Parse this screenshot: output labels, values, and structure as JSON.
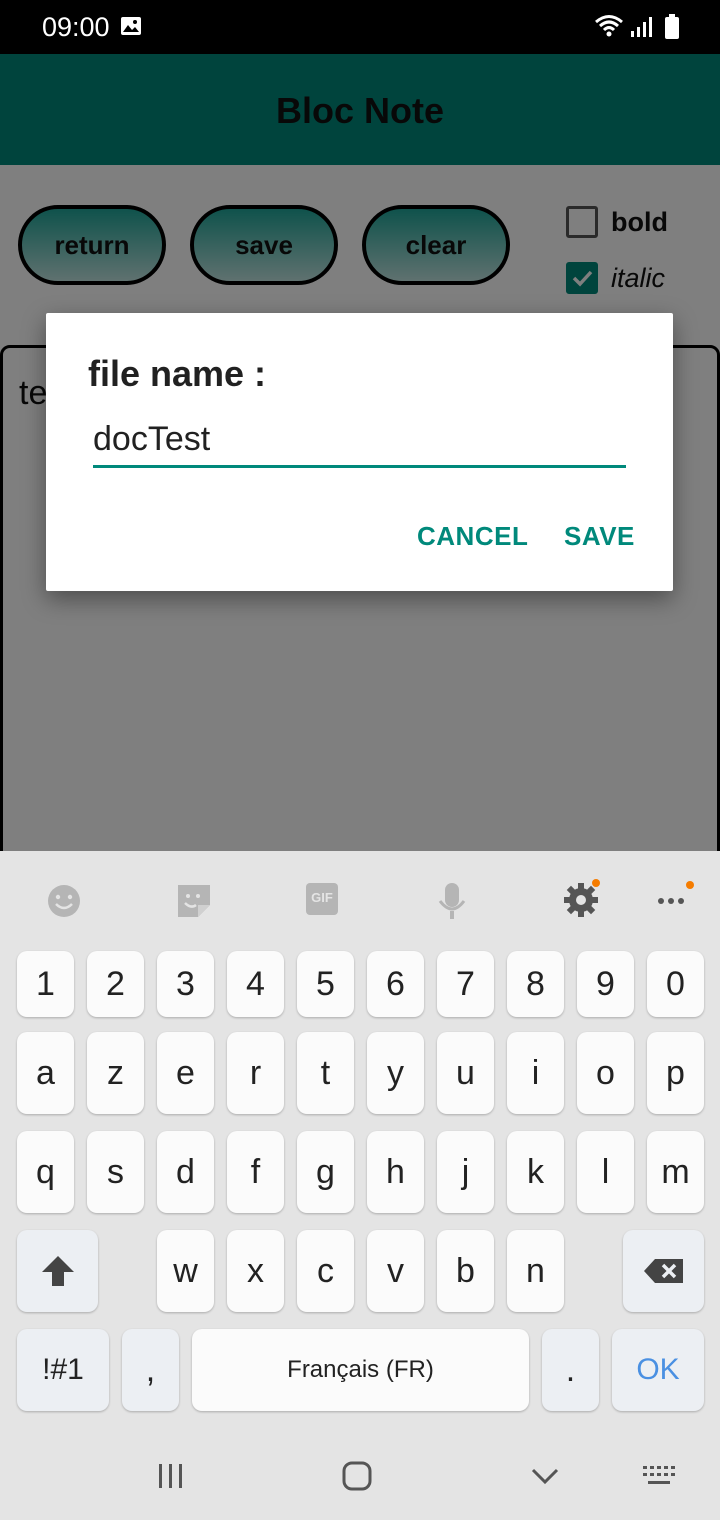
{
  "status_bar": {
    "time": "09:00"
  },
  "app": {
    "title": "Bloc Note"
  },
  "toolbar": {
    "return_label": "return",
    "save_label": "save",
    "clear_label": "clear",
    "bold_label": "bold",
    "bold_checked": false,
    "italic_label": "italic",
    "italic_checked": true
  },
  "editor": {
    "content": "te"
  },
  "dialog": {
    "title": "file name :",
    "filename_value": "docTest",
    "cancel_label": "CANCEL",
    "save_label": "SAVE"
  },
  "keyboard": {
    "toolbar_icons": [
      "emoji-icon",
      "sticker-icon",
      "gif-icon",
      "microphone-icon",
      "settings-icon",
      "more-icon"
    ],
    "gif_label": "GIF",
    "number_row": [
      "1",
      "2",
      "3",
      "4",
      "5",
      "6",
      "7",
      "8",
      "9",
      "0"
    ],
    "row1": [
      "a",
      "z",
      "e",
      "r",
      "t",
      "y",
      "u",
      "i",
      "o",
      "p"
    ],
    "row2": [
      "q",
      "s",
      "d",
      "f",
      "g",
      "h",
      "j",
      "k",
      "l",
      "m"
    ],
    "row3": [
      "w",
      "x",
      "c",
      "v",
      "b",
      "n"
    ],
    "symbols_label": "!#1",
    "comma_label": ",",
    "space_label": "Français (FR)",
    "period_label": ".",
    "ok_label": "OK"
  },
  "colors": {
    "accent": "#00897b",
    "notification_dot": "#f57c00",
    "ok_key_text": "#4a90e2"
  }
}
